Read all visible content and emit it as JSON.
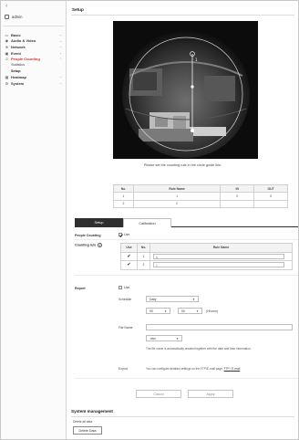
{
  "sidebar": {
    "back_glyph": "‹",
    "user": "admin",
    "items": [
      {
        "label": "Basic",
        "icon": "monitor-icon",
        "glyph": "▭"
      },
      {
        "label": "Audio & Video",
        "icon": "camera-icon",
        "glyph": "◉"
      },
      {
        "label": "Network",
        "icon": "globe-icon",
        "glyph": "⊕"
      },
      {
        "label": "Event",
        "icon": "bell-icon",
        "glyph": "▣"
      },
      {
        "label": "People Counting",
        "icon": "people-icon",
        "glyph": "☺"
      }
    ],
    "sub_items": [
      "Statistics",
      "Setup"
    ],
    "items2": [
      {
        "label": "Heatmap",
        "icon": "heatmap-icon",
        "glyph": "▦"
      },
      {
        "label": "System",
        "icon": "gear-icon",
        "glyph": "⚙"
      }
    ]
  },
  "main": {
    "title": "Setup",
    "caption": "Please set the counting rule in the circle guide line.",
    "rules_table": {
      "headers": [
        "No.",
        "Rule Name",
        "IN",
        "OUT"
      ],
      "rows": [
        [
          "1",
          "1",
          "0",
          "0"
        ],
        [
          "2",
          "2",
          "",
          ""
        ]
      ]
    },
    "tabs": [
      "Setup",
      "Calibration"
    ],
    "people_counting": {
      "label": "People Counting",
      "use": "Use"
    },
    "counting_rule": {
      "label": "Counting rule",
      "info": "i",
      "headers": [
        "Use",
        "No.",
        "Rule Name"
      ],
      "rows": [
        {
          "no": "1",
          "value": "1"
        },
        {
          "no": "2",
          "value": "2"
        }
      ]
    },
    "report": {
      "label": "Report",
      "use": "Use",
      "schedule_label": "Schedule",
      "schedule_value": "Daily",
      "time_from": "00",
      "time_sep": ":",
      "time_to": "00",
      "time_unit": "(Hh:mm)",
      "file_name_label": "File Name",
      "ext_value": ".xlsx",
      "file_note": "The file name is automatically created together with the date and time information.",
      "export_label": "Export",
      "export_note": "You can configure detailed settings on the FTP/E-mail page.",
      "export_link": "FTP / E-mail"
    },
    "buttons": {
      "cancel": "Cancel",
      "apply": "Apply"
    }
  },
  "system_management": {
    "title": "System management",
    "delete_label": "Delete all data",
    "delete_button": "Delete Data"
  },
  "colors": {
    "accent": "#c8322f",
    "tab_active": "#2f2f2f"
  }
}
